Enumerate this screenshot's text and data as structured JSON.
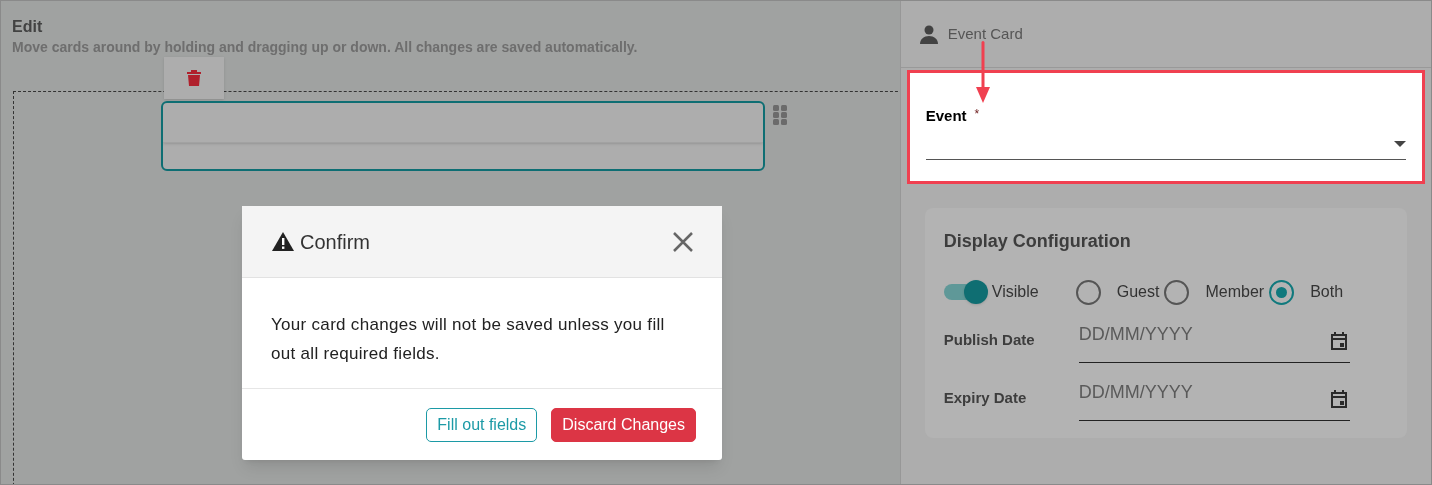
{
  "editor": {
    "title": "Edit",
    "subtitle": "Move cards around by holding and dragging up or down. All changes are saved automatically."
  },
  "side_panel": {
    "header": "Event Card",
    "event_field": {
      "label": "Event",
      "required_mark": "*"
    },
    "display_configuration": {
      "title": "Display Configuration",
      "visible_toggle": {
        "label": "Visible",
        "on": true
      },
      "audience": [
        {
          "label": "Guest",
          "selected": false
        },
        {
          "label": "Member",
          "selected": false
        },
        {
          "label": "Both",
          "selected": true
        }
      ],
      "dates": [
        {
          "label": "Publish Date",
          "placeholder": "DD/MM/YYYY"
        },
        {
          "label": "Expiry Date",
          "placeholder": "DD/MM/YYYY"
        }
      ]
    }
  },
  "dialog": {
    "title": "Confirm",
    "message": "Your card changes will not be saved unless you fill out all required fields.",
    "buttons": [
      {
        "label": "Fill out fields",
        "kind": "outline"
      },
      {
        "label": "Discard Changes",
        "kind": "danger"
      }
    ]
  }
}
